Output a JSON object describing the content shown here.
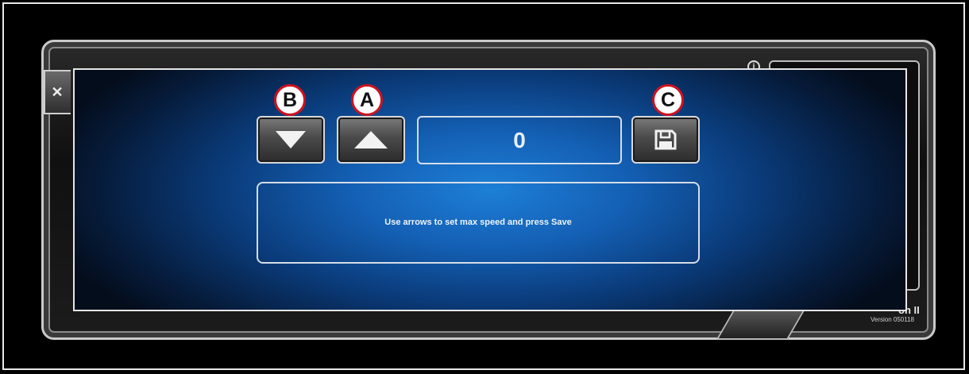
{
  "display": {
    "value": "0"
  },
  "message": {
    "text": "Use arrows to set max speed and press Save"
  },
  "callouts": {
    "a": "A",
    "b": "B",
    "c": "C"
  },
  "background": {
    "brand_fragment": "on II",
    "version": "Version 050118"
  },
  "icons": {
    "close": "close-icon",
    "down": "down-arrow-icon",
    "up": "up-arrow-icon",
    "save": "save-icon",
    "info": "info-icon"
  },
  "colors": {
    "dialog_blue": "#1460b5",
    "callout_red": "#d0121f"
  }
}
